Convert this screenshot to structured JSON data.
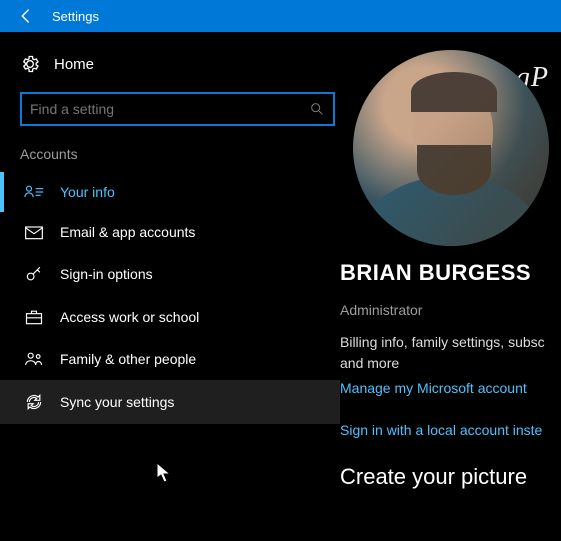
{
  "titlebar": {
    "title": "Settings"
  },
  "sidebar": {
    "home": "Home",
    "search_placeholder": "Find a setting",
    "section": "Accounts",
    "items": [
      {
        "label": "Your info"
      },
      {
        "label": "Email & app accounts"
      },
      {
        "label": "Sign-in options"
      },
      {
        "label": "Access work or school"
      },
      {
        "label": "Family & other people"
      },
      {
        "label": "Sync your settings"
      }
    ]
  },
  "main": {
    "watermark": "gP",
    "user_name": "BRIAN BURGESS",
    "role": "Administrator",
    "description": "Billing info, family settings, subsc and more",
    "manage_link": "Manage my Microsoft account",
    "local_link": "Sign in with a local account inste",
    "picture_heading": "Create your picture"
  }
}
